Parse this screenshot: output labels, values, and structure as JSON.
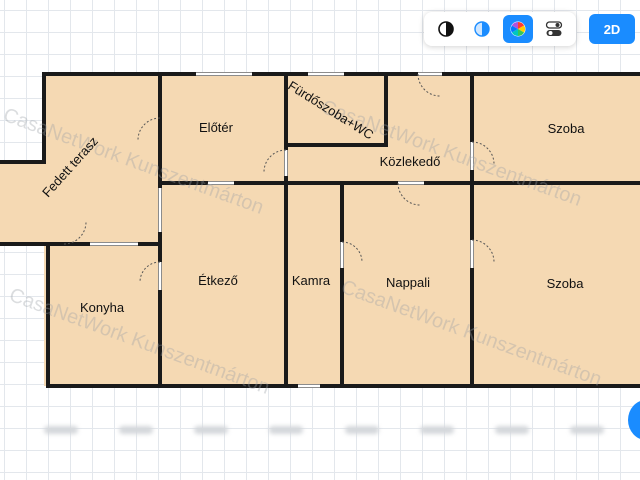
{
  "watermark": "CasaNetWork Kunszentmárton",
  "rooms": {
    "fedett_terasz": "Fedett terasz",
    "eloter": "Előtér",
    "furdoszoba_wc": "Fürdőszoba+WC",
    "kozlekedo": "Közlekedő",
    "szoba_top": "Szoba",
    "konyha": "Konyha",
    "etkezo": "Étkező",
    "kamra": "Kamra",
    "nappali": "Nappali",
    "szoba_bottom": "Szoba"
  },
  "toolbar": {
    "icons": [
      "contrast-icon",
      "half-circle-icon",
      "color-wheel-icon",
      "toggle-icon"
    ],
    "view_button_label": "2D"
  },
  "colors": {
    "floor": "#f5d9b3",
    "wall": "#1a1a1a",
    "accent": "#1a8cff"
  }
}
